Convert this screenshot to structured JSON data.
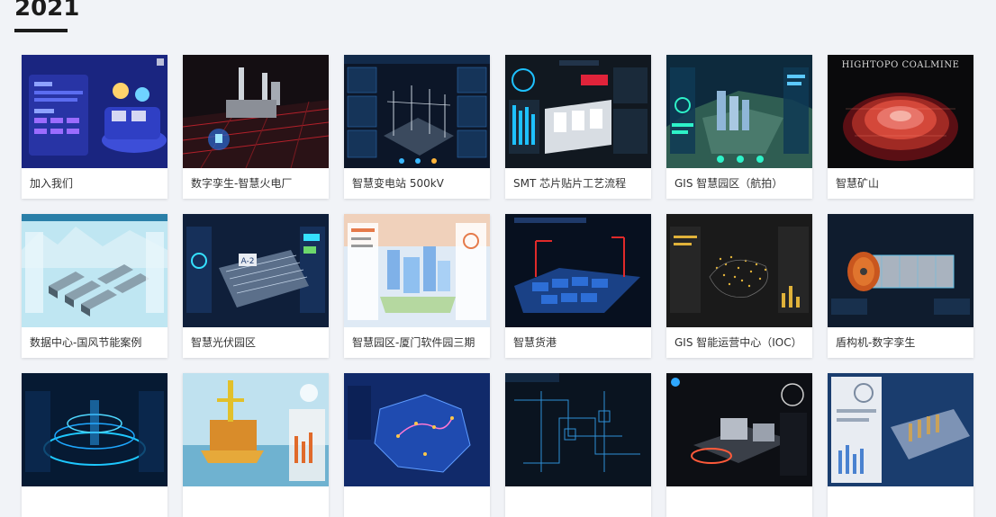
{
  "section": {
    "year": "2021"
  },
  "cards": [
    {
      "title": "加入我们",
      "thumb": "join-us-illustration"
    },
    {
      "title": "数字孪生-智慧火电厂",
      "thumb": "thermal-power-plant"
    },
    {
      "title": "智慧变电站 500kV",
      "thumb": "substation"
    },
    {
      "title": "SMT 芯片贴片工艺流程",
      "thumb": "smt-production-line"
    },
    {
      "title": "GIS 智慧园区（航拍）",
      "thumb": "aerial-park"
    },
    {
      "title": "智慧矿山",
      "thumb": "coal-mine",
      "image_text": "HIGHTOPO COALMINE"
    },
    {
      "title": "数据中心-国风节能案例",
      "thumb": "data-center"
    },
    {
      "title": "智慧光伏园区",
      "thumb": "solar-park"
    },
    {
      "title": "智慧园区-厦门软件园三期",
      "thumb": "software-park"
    },
    {
      "title": "智慧货港",
      "thumb": "cargo-port"
    },
    {
      "title": "GIS 智能运营中心（IOC）",
      "thumb": "ioc-map"
    },
    {
      "title": "盾构机-数字孪生",
      "thumb": "tunnel-boring-machine"
    },
    {
      "title": "",
      "thumb": "blue-hologram"
    },
    {
      "title": "",
      "thumb": "offshore-platform"
    },
    {
      "title": "",
      "thumb": "region-map"
    },
    {
      "title": "",
      "thumb": "pipeline-schematic"
    },
    {
      "title": "",
      "thumb": "industrial-equipment"
    },
    {
      "title": "",
      "thumb": "warehouse-dashboard"
    }
  ]
}
